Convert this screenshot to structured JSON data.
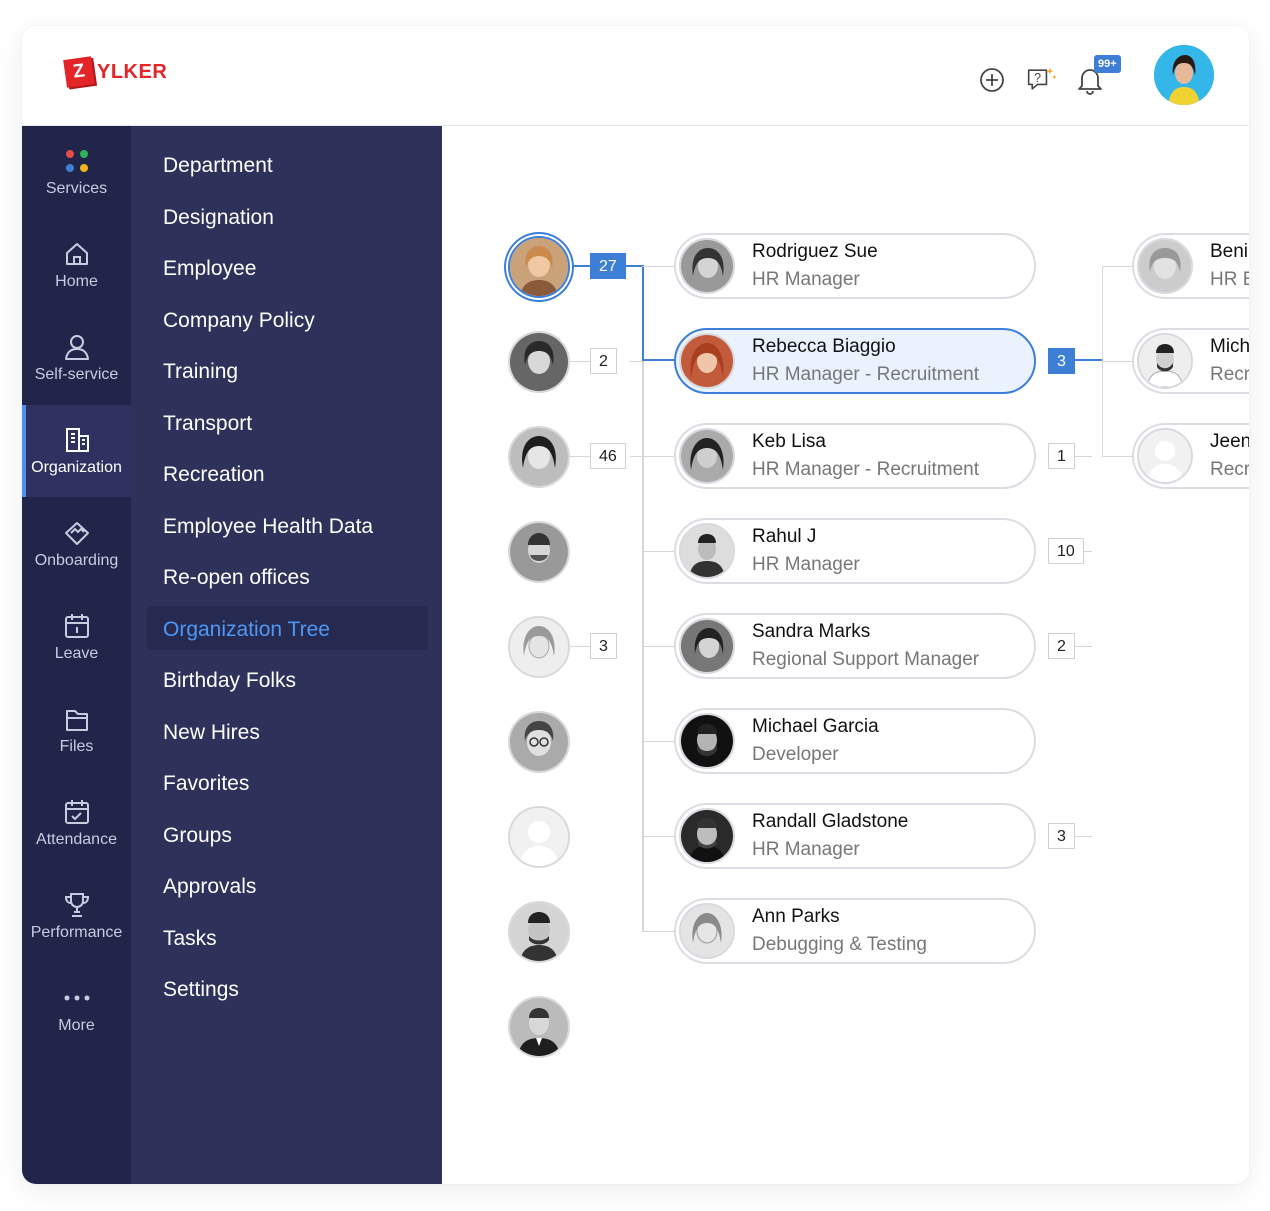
{
  "app": {
    "logo_letter": "Z",
    "logo_text": "YLKER",
    "notification_badge": "99+",
    "brand_color": "#e42527",
    "accent_color": "#3d7ed6"
  },
  "rail": [
    {
      "label": "Services",
      "icon": "services-dots-icon"
    },
    {
      "label": "Home",
      "icon": "home-icon"
    },
    {
      "label": "Self-service",
      "icon": "person-icon"
    },
    {
      "label": "Organization",
      "icon": "building-icon",
      "active": true
    },
    {
      "label": "Onboarding",
      "icon": "handshake-icon"
    },
    {
      "label": "Leave",
      "icon": "calendar-icon"
    },
    {
      "label": "Files",
      "icon": "files-icon"
    },
    {
      "label": "Attendance",
      "icon": "calendar-check-icon"
    },
    {
      "label": "Performance",
      "icon": "trophy-icon"
    },
    {
      "label": "More",
      "icon": "more-dots-icon"
    }
  ],
  "submenu": [
    "Department",
    "Designation",
    "Employee",
    "Company Policy",
    "Training",
    "Transport",
    "Recreation",
    "Employee Health Data",
    "Re-open offices",
    "Organization Tree",
    "Birthday Folks",
    "New Hires",
    "Favorites",
    "Groups",
    "Approvals",
    "Tasks",
    "Settings"
  ],
  "submenu_active": "Organization Tree",
  "tree": {
    "level1_counts": [
      "27",
      "2",
      "46",
      "",
      "3",
      "",
      "",
      "",
      ""
    ],
    "level2": [
      {
        "name": "Rodriguez Sue",
        "role": "HR Manager",
        "count": ""
      },
      {
        "name": "Rebecca Biaggio",
        "role": "HR Manager - Recruitment",
        "count": "3",
        "selected": true
      },
      {
        "name": "Keb Lisa",
        "role": "HR Manager - Recruitment",
        "count": "1"
      },
      {
        "name": "Rahul J",
        "role": "HR Manager",
        "count": "10"
      },
      {
        "name": "Sandra Marks",
        "role": "Regional Support Manager",
        "count": "2"
      },
      {
        "name": "Michael Garcia",
        "role": "Developer",
        "count": ""
      },
      {
        "name": "Randall Gladstone",
        "role": "HR Manager",
        "count": "3"
      },
      {
        "name": "Ann Parks",
        "role": "Debugging & Testing",
        "count": ""
      }
    ],
    "level3": [
      {
        "name": "Beni",
        "role": "HR E"
      },
      {
        "name": "Mich",
        "role": "Recr"
      },
      {
        "name": "Jeen",
        "role": "Recr"
      }
    ]
  }
}
